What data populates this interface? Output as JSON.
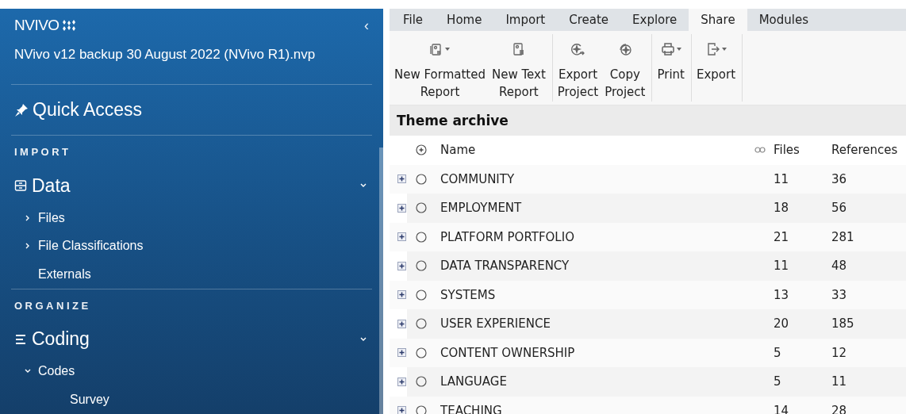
{
  "sidebar": {
    "logo": "NVIVO",
    "collapse": "‹",
    "project": "NVivo v12 backup 30 August 2022 (NVivo R1).nvp",
    "quick_access": "Quick Access",
    "sections": [
      {
        "label": "IMPORT",
        "groups": [
          {
            "label": "Data",
            "kind": "data",
            "expanded": true,
            "children": [
              {
                "label": "Files",
                "kind": "folder",
                "expanded": false
              },
              {
                "label": "File Classifications",
                "kind": "folder",
                "expanded": false
              },
              {
                "label": "Externals",
                "kind": "leaf"
              }
            ]
          }
        ]
      },
      {
        "label": "ORGANIZE",
        "groups": [
          {
            "label": "Coding",
            "kind": "coding",
            "expanded": true,
            "children": [
              {
                "label": "Codes",
                "kind": "folder",
                "expanded": true,
                "children": [
                  {
                    "label": "Survey",
                    "kind": "leaf"
                  }
                ]
              }
            ]
          }
        ]
      }
    ]
  },
  "tabs": [
    {
      "label": "File",
      "selected": false
    },
    {
      "label": "Home",
      "selected": false
    },
    {
      "label": "Import",
      "selected": false
    },
    {
      "label": "Create",
      "selected": false
    },
    {
      "label": "Explore",
      "selected": false
    },
    {
      "label": "Share",
      "selected": true
    },
    {
      "label": "Modules",
      "selected": false
    }
  ],
  "ribbon": [
    [
      {
        "label": "New Formatted\nReport",
        "kind": "formatted-report",
        "dropdown": true
      },
      {
        "label": "New Text\nReport",
        "kind": "text-report",
        "dropdown": false
      }
    ],
    [
      {
        "label": "Export\nProject",
        "kind": "export-project",
        "dropdown": false
      },
      {
        "label": "Copy\nProject",
        "kind": "copy-project",
        "dropdown": false
      }
    ],
    [
      {
        "label": "Print",
        "kind": "print",
        "dropdown": true
      }
    ],
    [
      {
        "label": "Export",
        "kind": "export",
        "dropdown": true
      }
    ]
  ],
  "view_title": "Theme archive",
  "table": {
    "columns": [
      "Name",
      "Files",
      "References"
    ],
    "rows": [
      {
        "name": "COMMUNITY",
        "files": "11",
        "references": "36"
      },
      {
        "name": "EMPLOYMENT",
        "files": "18",
        "references": "56"
      },
      {
        "name": "PLATFORM PORTFOLIO",
        "files": "21",
        "references": "281"
      },
      {
        "name": "DATA TRANSPARENCY",
        "files": "11",
        "references": "48"
      },
      {
        "name": "SYSTEMS",
        "files": "13",
        "references": "33"
      },
      {
        "name": "USER EXPERIENCE",
        "files": "20",
        "references": "185"
      },
      {
        "name": "CONTENT OWNERSHIP",
        "files": "5",
        "references": "12"
      },
      {
        "name": "LANGUAGE",
        "files": "5",
        "references": "11"
      },
      {
        "name": "TEACHING",
        "files": "14",
        "references": "28"
      }
    ]
  }
}
